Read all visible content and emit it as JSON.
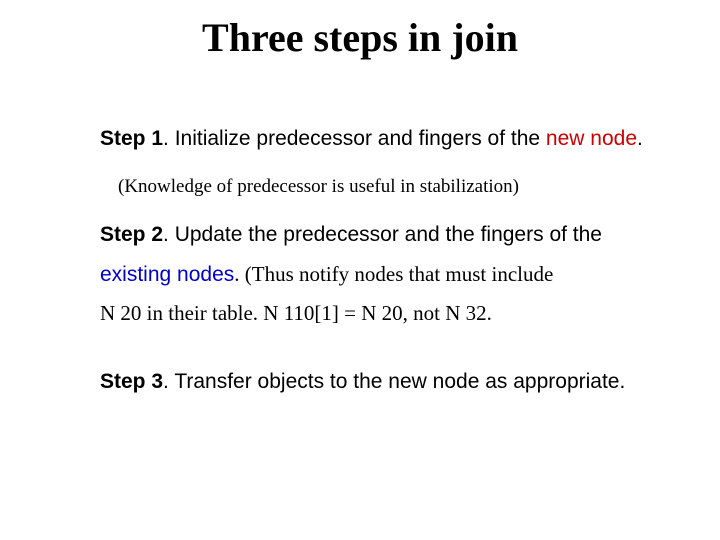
{
  "title": "Three steps in join",
  "step1": {
    "label": "Step 1",
    "text_before": ". Initialize predecessor and fingers of the ",
    "highlight": "new node",
    "text_after": "."
  },
  "note": "(Knowledge of predecessor is useful in stabilization)",
  "step2": {
    "label": "Step 2",
    "text_plain": ". Update the predecessor and the fingers of the",
    "highlight": "existing nodes",
    "serif_part1": ". (Thus notify nodes that must include",
    "serif_part2": "N 20 in their table. N 110[1] = N 20, not N 32."
  },
  "step3": {
    "label": "Step 3",
    "text": ". Transfer objects to the new node as appropriate."
  }
}
